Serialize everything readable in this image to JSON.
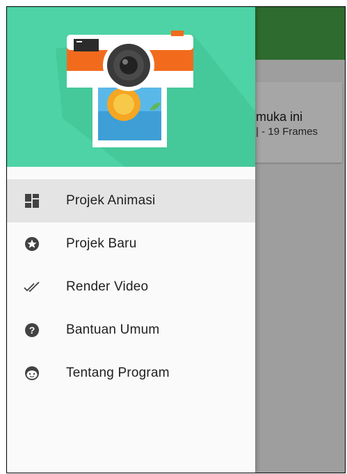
{
  "background_app": {
    "card_title": "muka ini",
    "card_subtitle": "| - 19 Frames"
  },
  "drawer": {
    "header_image": "camera-illustration",
    "accent_color": "#4dd3a5",
    "items": [
      {
        "label": "Projek Animasi",
        "icon": "dashboard-icon",
        "active": true
      },
      {
        "label": "Projek Baru",
        "icon": "star-circle-icon",
        "active": false
      },
      {
        "label": "Render Video",
        "icon": "double-check-icon",
        "active": false
      },
      {
        "label": "Bantuan Umum",
        "icon": "help-icon",
        "active": false
      },
      {
        "label": "Tentang Program",
        "icon": "face-icon",
        "active": false
      }
    ]
  }
}
